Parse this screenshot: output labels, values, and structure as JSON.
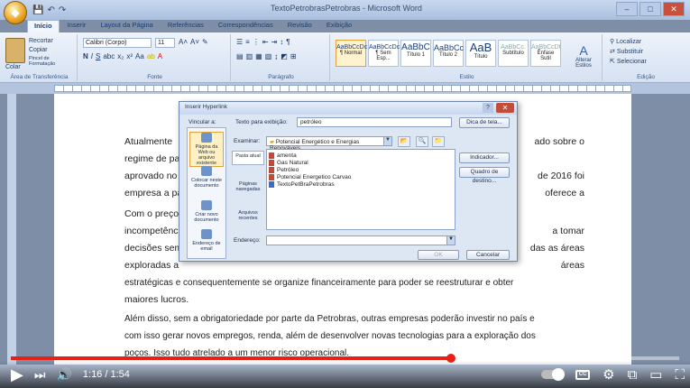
{
  "window": {
    "title": "TextoPetrobrasPetrobras - Microsoft Word",
    "controls": [
      "–",
      "□",
      "✕"
    ],
    "qat": [
      "💾",
      "↶",
      "↷"
    ]
  },
  "tabs": [
    "Início",
    "Inserir",
    "Layout da Página",
    "Referências",
    "Correspondências",
    "Revisão",
    "Exibição"
  ],
  "ribbon": {
    "clipboard": {
      "paste": "Colar",
      "cut": "Recortar",
      "copy": "Copiar",
      "format": "Pincel de Formatação",
      "label": "Área de Transferência"
    },
    "font": {
      "name": "Calibri (Corpo)",
      "size": "11",
      "label": "Fonte"
    },
    "paragraph": {
      "label": "Parágrafo"
    },
    "styles": {
      "label": "Estilo",
      "items": [
        {
          "sample": "AaBbCcDc",
          "name": "¶ Normal"
        },
        {
          "sample": "AaBbCcDc",
          "name": "¶ Sem Esp..."
        },
        {
          "sample": "AaBbC",
          "name": "Título 1"
        },
        {
          "sample": "AaBbCc",
          "name": "Título 2"
        },
        {
          "sample": "AaB",
          "name": "Título"
        },
        {
          "sample": "AaBbCc.",
          "name": "Subtítulo"
        },
        {
          "sample": "AaBbCcDt",
          "name": "Ênfase Sutil"
        }
      ],
      "change": "Alterar Estilos"
    },
    "editing": {
      "find": "Localizar",
      "replace": "Substituir",
      "select": "Selecionar",
      "label": "Edição"
    }
  },
  "document": {
    "paragraphs": [
      "Atualmente",
      "regime de pa",
      "aprovado no",
      "empresa a pa",
      "ado sobre o",
      "de 2016 foi",
      "oferece a"
    ],
    "para2_lines": [
      "Com o preço",
      "incompetênc",
      "decisões sem",
      "exploradas a"
    ],
    "para2_right": [
      "a tomar",
      "das as áreas",
      "áreas"
    ],
    "para2_last": "estratégicas e consequentemente se organize financeiramente para poder se reestruturar e obter",
    "para2_end": "maiores lucros.",
    "para3": [
      "Além disso, sem a obrigatoriedade por parte da Petrobras, outras empresas poderão investir no país e",
      "com isso gerar novos empregos, renda, além de desenvolver novas tecnologias para a exploração dos",
      "poços. Isso tudo atrelado a um menor risco operacional."
    ]
  },
  "dialog": {
    "title": "Inserir Hyperlink",
    "help": "?",
    "close": "✕",
    "link_to_label": "Vincular a:",
    "text_label": "Texto para exibição:",
    "text_value": "petróleo",
    "tooltip_btn": "Dica de tela...",
    "link_options": [
      "Página da Web ou arquivo existente",
      "Colocar neste documento",
      "Criar novo documento",
      "Endereço de email"
    ],
    "look_in_label": "Examinar:",
    "look_in_value": "Potencial Energético e Energias Renováveis",
    "sub_options": [
      "Pasta atual",
      "Páginas navegadas",
      "Arquivos recentes"
    ],
    "files": [
      "amenta",
      "Gas Natural",
      "Petróleo",
      "Potencial Energetico Carvao",
      "TextoPetBraPetrobras"
    ],
    "bookmark_btn": "Indicador...",
    "target_btn": "Quadro de destino...",
    "address_label": "Endereço:",
    "address_value": "",
    "ok": "OK",
    "cancel": "Cancelar"
  },
  "player": {
    "play": "▶",
    "next": "⏭",
    "volume": "🔊",
    "time": "1:16 / 1:54",
    "progress_fraction": 0.659,
    "cc": "CC",
    "settings": "⚙",
    "miniplayer": "⧉",
    "theater": "▭",
    "fullscreen": "⛶",
    "accent": "#e62117"
  }
}
